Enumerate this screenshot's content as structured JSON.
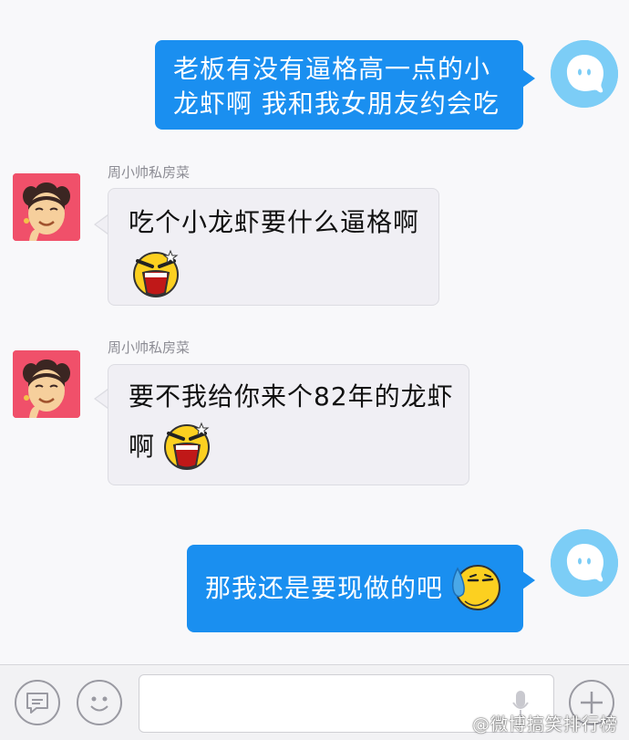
{
  "messages": {
    "m1": {
      "lines": [
        "老板有没有逼格高一点的小",
        "龙虾啊 我和我女朋友约会吃"
      ]
    },
    "m2": {
      "sender": "周小帅私房菜",
      "text": "吃个小龙虾要什么逼格啊",
      "emoji": "shouting-face-emoji"
    },
    "m3": {
      "sender": "周小帅私房菜",
      "line1": "要不我给你来个82年的龙虾",
      "line2": "啊",
      "emoji": "shouting-face-emoji"
    },
    "m4": {
      "text": "那我还是要现做的吧",
      "emoji": "sweat-moon-face-emoji"
    }
  },
  "avatars": {
    "self": {
      "icon": "qq-penguin-icon",
      "color": "#7ccdf6"
    },
    "shop": {
      "icon": "cartoon-face-icon",
      "color": "#f0506a"
    }
  },
  "bottom_bar": {
    "voice_button_icon": "message-bubble-icon",
    "emoji_button_icon": "smiley-icon",
    "mic_icon": "microphone-icon",
    "plus_button_icon": "plus-icon",
    "watermark": "@微博搞笑排行榜"
  },
  "colors": {
    "outgoing_bubble": "#1a8ff0",
    "incoming_bubble": "#f0eff4",
    "background": "#f8f8fa"
  }
}
